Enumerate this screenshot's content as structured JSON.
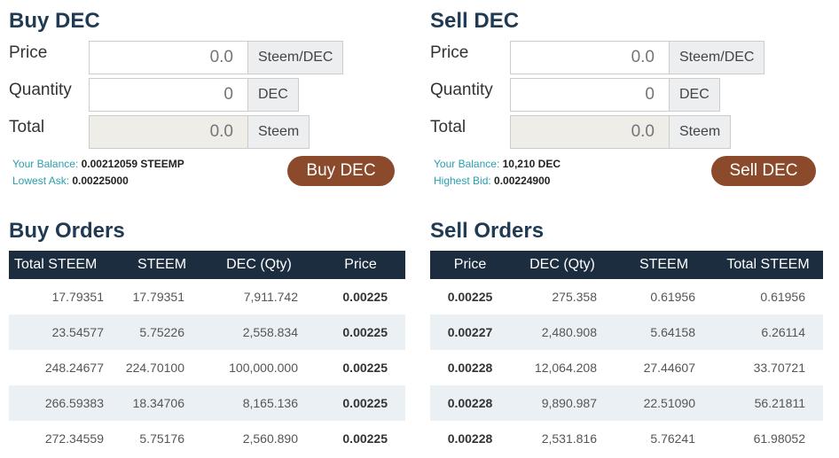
{
  "buy": {
    "title": "Buy DEC",
    "price_label": "Price",
    "price_value": "0.0",
    "price_unit": "Steem/DEC",
    "qty_label": "Quantity",
    "qty_value": "0",
    "qty_unit": "DEC",
    "total_label": "Total",
    "total_value": "0.0",
    "total_unit": "Steem",
    "balance_label": "Your Balance:",
    "balance_value": "0.00212059 STEEMP",
    "ask_label": "Lowest Ask:",
    "ask_value": "0.00225000",
    "button": "Buy DEC"
  },
  "sell": {
    "title": "Sell DEC",
    "price_label": "Price",
    "price_value": "0.0",
    "price_unit": "Steem/DEC",
    "qty_label": "Quantity",
    "qty_value": "0",
    "qty_unit": "DEC",
    "total_label": "Total",
    "total_value": "0.0",
    "total_unit": "Steem",
    "balance_label": "Your Balance:",
    "balance_value": "10,210 DEC",
    "bid_label": "Highest Bid:",
    "bid_value": "0.00224900",
    "button": "Sell DEC"
  },
  "buy_orders": {
    "title": "Buy Orders",
    "columns": [
      "Total STEEM",
      "STEEM",
      "DEC (Qty)",
      "Price"
    ],
    "rows": [
      [
        "17.79351",
        "17.79351",
        "7,911.742",
        "0.00225"
      ],
      [
        "23.54577",
        "5.75226",
        "2,558.834",
        "0.00225"
      ],
      [
        "248.24677",
        "224.70100",
        "100,000.000",
        "0.00225"
      ],
      [
        "266.59383",
        "18.34706",
        "8,165.136",
        "0.00225"
      ],
      [
        "272.34559",
        "5.75176",
        "2,560.890",
        "0.00225"
      ]
    ]
  },
  "sell_orders": {
    "title": "Sell Orders",
    "columns": [
      "Price",
      "DEC (Qty)",
      "STEEM",
      "Total STEEM"
    ],
    "rows": [
      [
        "0.00225",
        "275.358",
        "0.61956",
        "0.61956"
      ],
      [
        "0.00227",
        "2,480.908",
        "5.64158",
        "6.26114"
      ],
      [
        "0.00228",
        "12,064.208",
        "27.44607",
        "33.70721"
      ],
      [
        "0.00228",
        "9,890.987",
        "22.51090",
        "56.21811"
      ],
      [
        "0.00228",
        "2,531.816",
        "5.76241",
        "61.98052"
      ]
    ]
  }
}
